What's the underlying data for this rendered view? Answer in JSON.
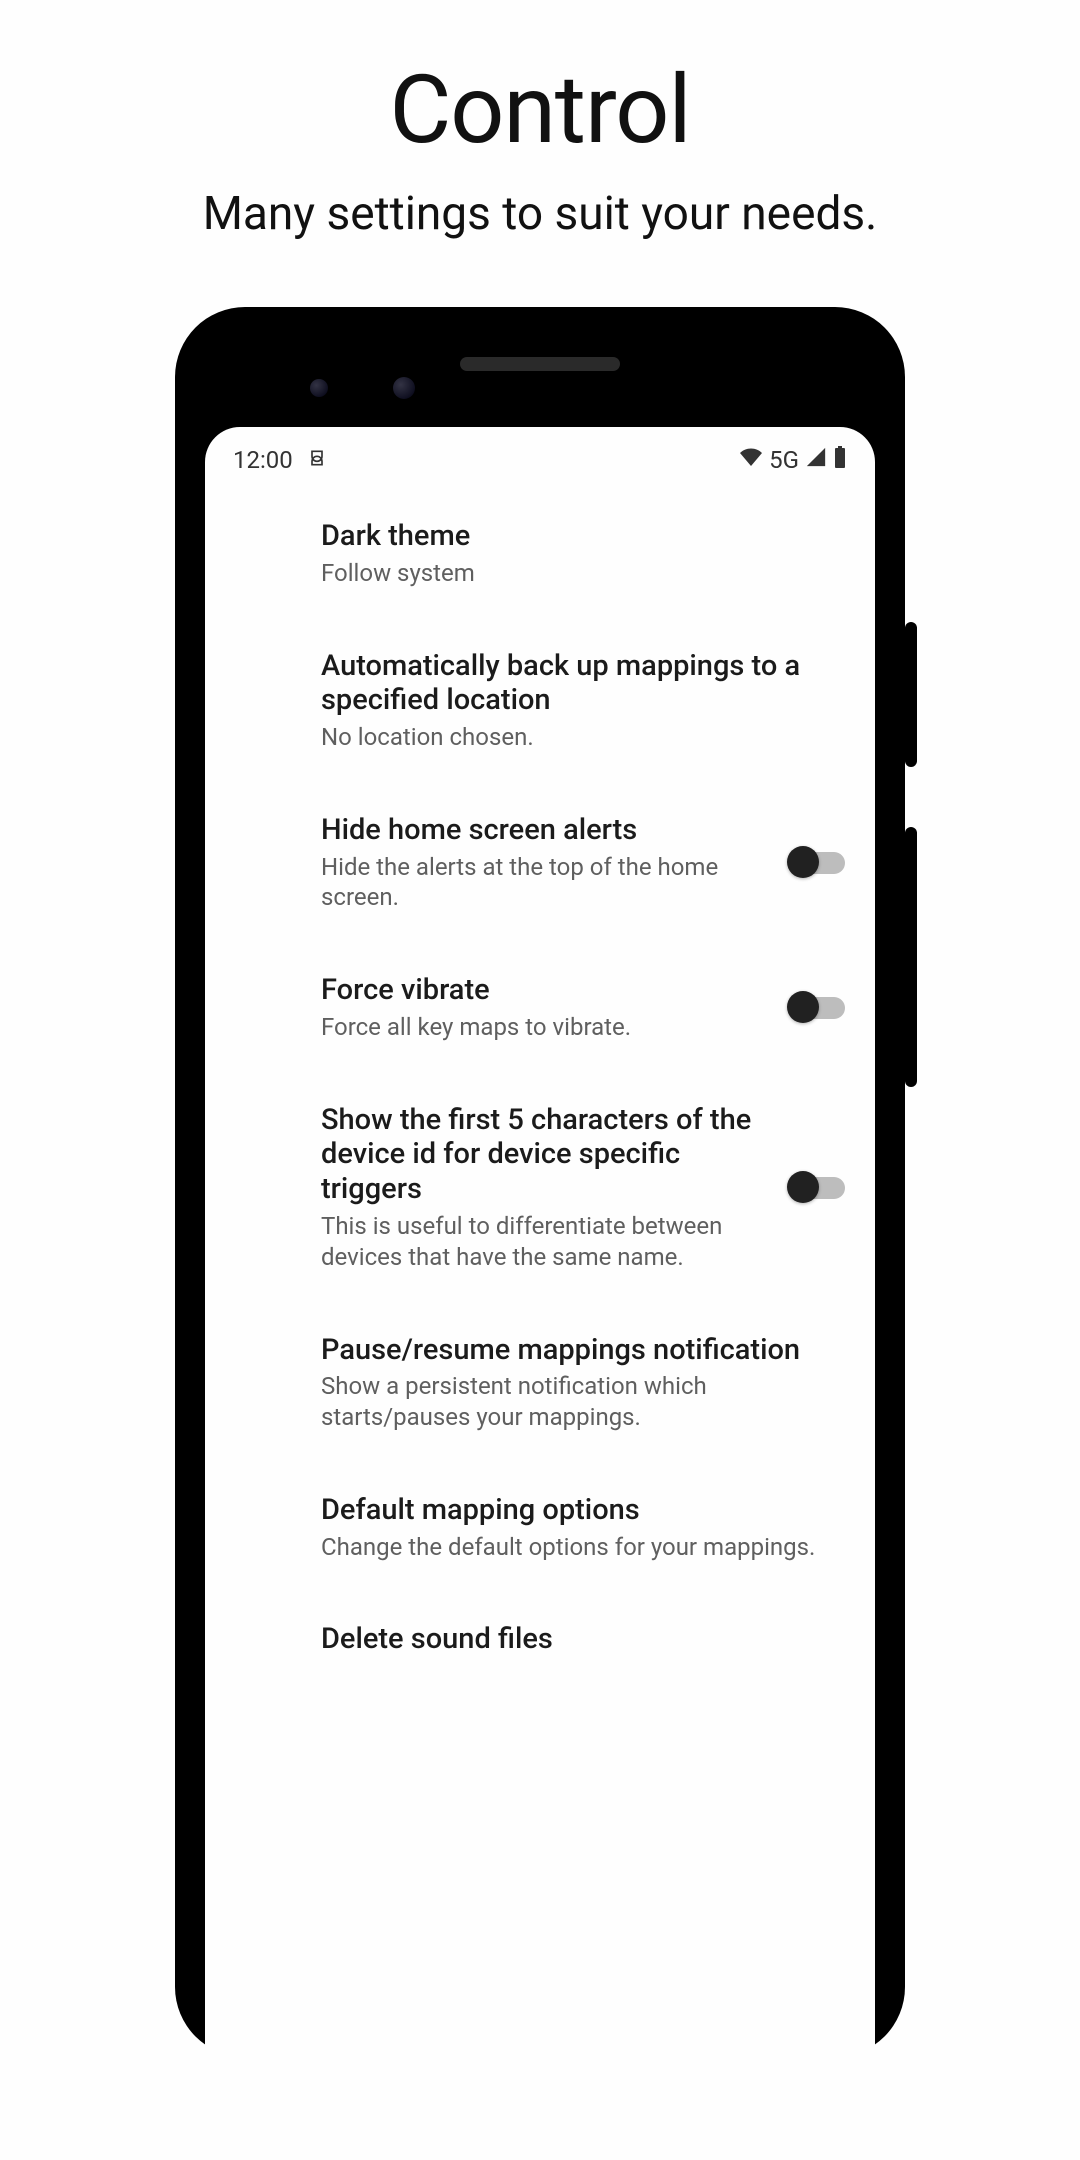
{
  "hero": {
    "title": "Control",
    "subtitle": "Many settings to suit your needs."
  },
  "status": {
    "time": "12:00",
    "network": "5G"
  },
  "settings": [
    {
      "title": "Dark theme",
      "desc": "Follow system",
      "toggle": false
    },
    {
      "title": "Automatically back up mappings to a specified location",
      "desc": "No location chosen.",
      "toggle": false
    },
    {
      "title": "Hide home screen alerts",
      "desc": "Hide the alerts at the top of the home screen.",
      "toggle": true
    },
    {
      "title": "Force vibrate",
      "desc": "Force all key maps to vibrate.",
      "toggle": true
    },
    {
      "title": "Show the first 5 characters of the device id for device specific triggers",
      "desc": "This is useful to differentiate between devices that have the same name.",
      "toggle": true
    },
    {
      "title": "Pause/resume mappings notification",
      "desc": "Show a persistent notification which starts/pauses your mappings.",
      "toggle": false
    },
    {
      "title": "Default mapping options",
      "desc": "Change the default options for your mappings.",
      "toggle": false
    },
    {
      "title": "Delete sound files",
      "desc": "",
      "toggle": false
    }
  ]
}
